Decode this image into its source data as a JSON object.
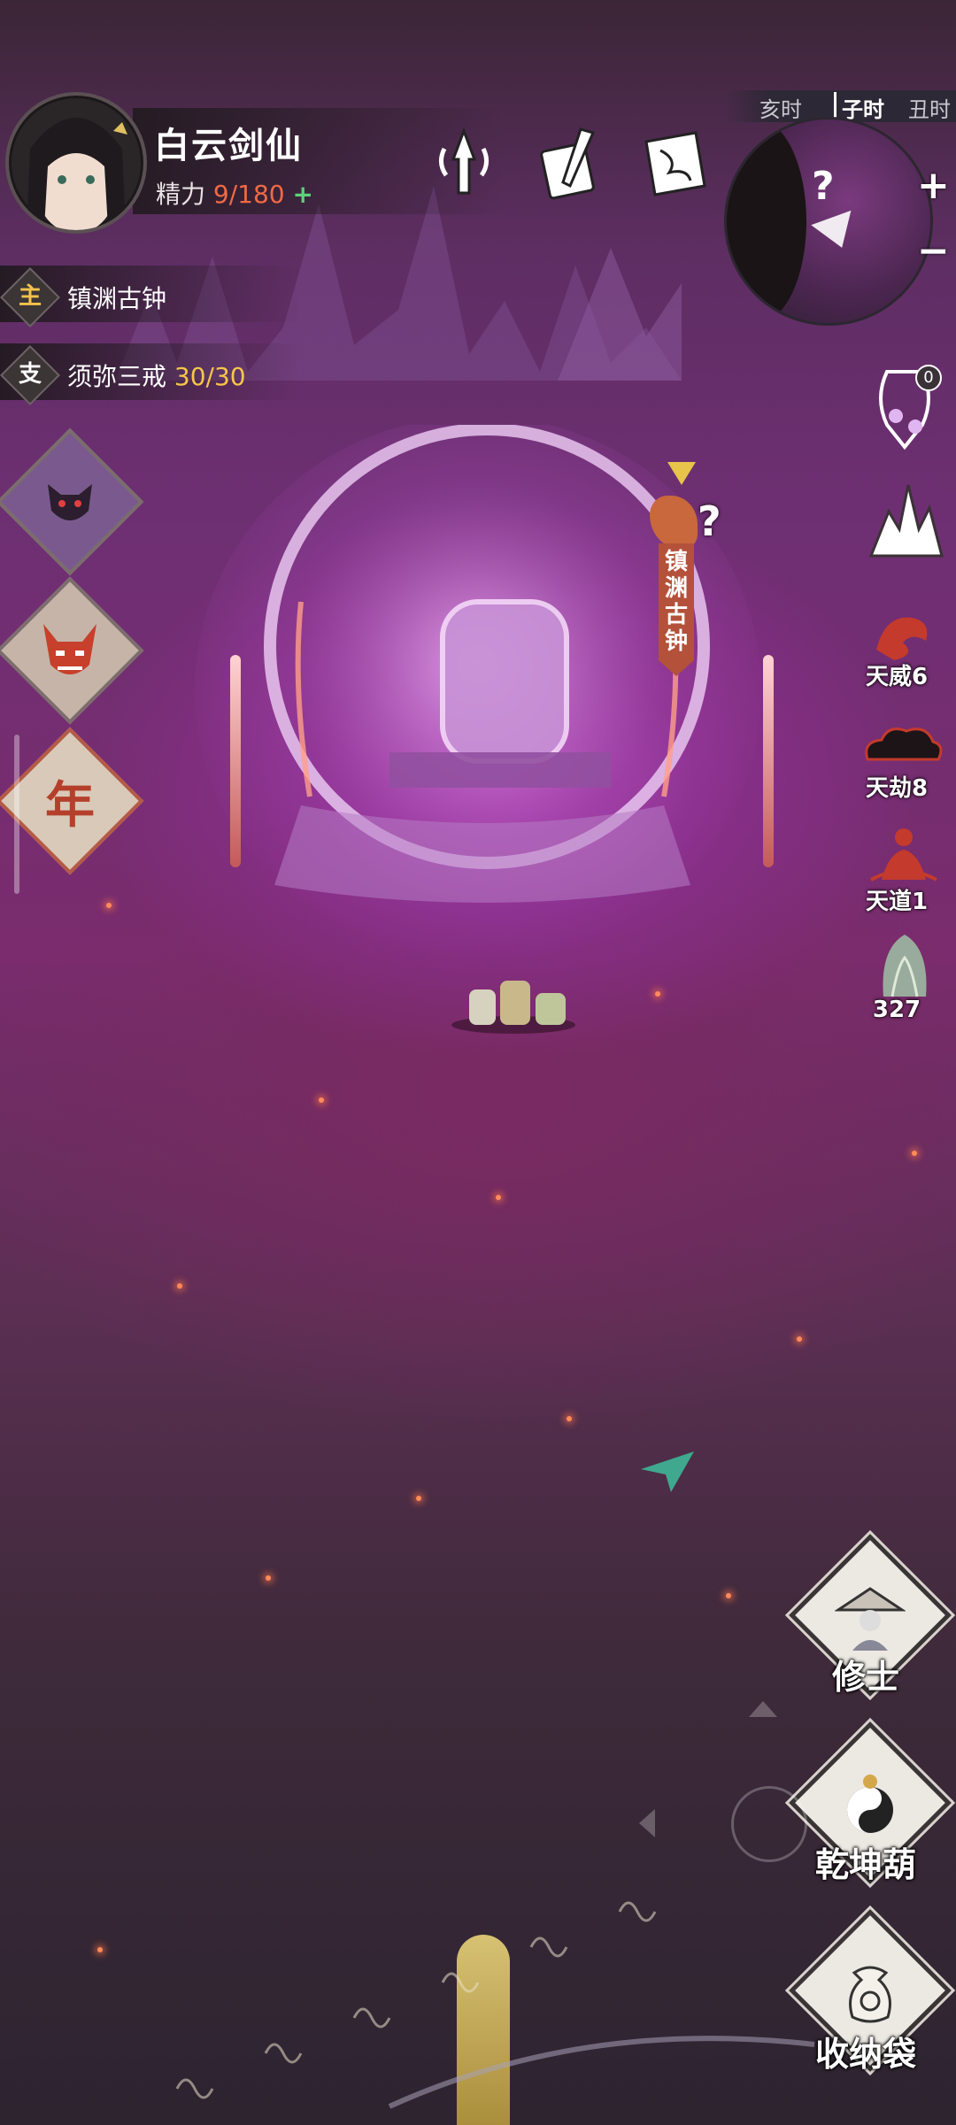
{
  "player": {
    "name": "白云剑仙",
    "stamina_label": "精力",
    "stamina_value": "9/180",
    "stamina_plus": "+"
  },
  "quests": [
    {
      "tag": "主",
      "text": "镇渊古钟",
      "count": ""
    },
    {
      "tag": "支",
      "text": "须弥三戒",
      "count": "30/30"
    }
  ],
  "time_strip": [
    "亥时",
    "子时",
    "丑时"
  ],
  "minimap": {
    "marker": "?",
    "zoom_in": "+",
    "zoom_out": "−"
  },
  "left_buttons": [
    {
      "icon": "demon-mask-icon"
    },
    {
      "icon": "oni-mask-icon"
    },
    {
      "icon": "year-icon",
      "label": "年"
    }
  ],
  "right_status": {
    "bell_count": "0",
    "items": [
      {
        "icon": "dragon-icon",
        "label": "天威6"
      },
      {
        "icon": "cloud-icon",
        "label": "天劫8"
      },
      {
        "icon": "meditation-icon",
        "label": "天道1"
      },
      {
        "icon": "ghost-icon",
        "label": "327"
      }
    ]
  },
  "boss": {
    "name": "镇渊古钟",
    "mark": "?"
  },
  "actions": [
    {
      "label": "修士",
      "icon": "cultivator-icon"
    },
    {
      "label": "乾坤葫",
      "icon": "gourd-icon"
    },
    {
      "label": "收纳袋",
      "icon": "storage-bag-icon"
    }
  ],
  "colors": {
    "stamina": "#f06a46",
    "quest_count": "#f5c64a",
    "banner": "#b4513a",
    "background": "#6f2f73"
  }
}
